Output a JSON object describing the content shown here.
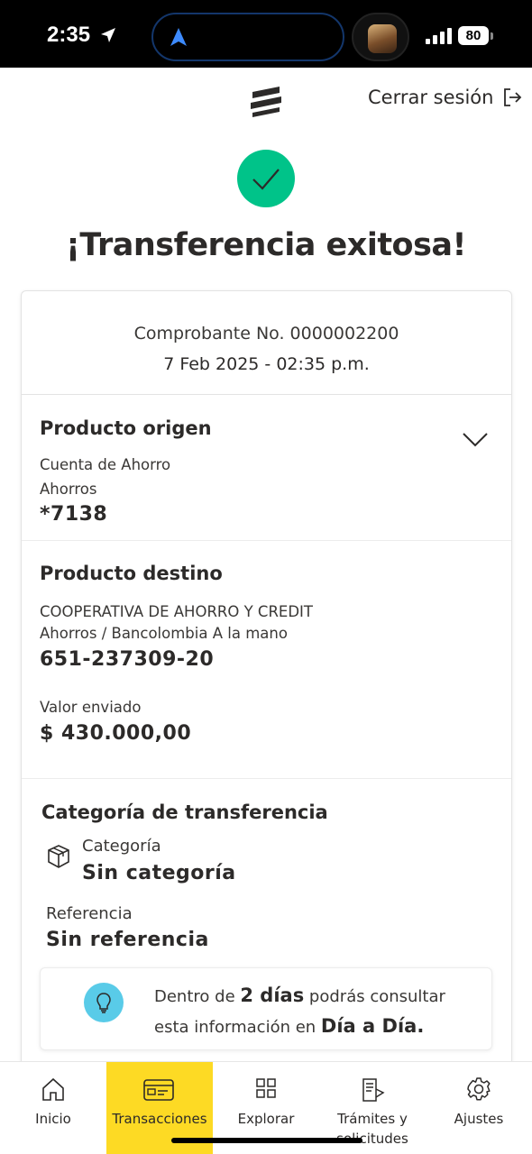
{
  "status_bar": {
    "time": "2:35",
    "battery": "80"
  },
  "header": {
    "logout_label": "Cerrar sesión"
  },
  "success": {
    "title": "¡Transferencia exitosa!"
  },
  "receipt": {
    "number": "Comprobante No. 0000002200",
    "date": "7 Feb 2025 - 02:35 p.m."
  },
  "origin": {
    "title": "Producto origen",
    "account_type": "Cuenta de Ahorro",
    "account_kind": "Ahorros",
    "account_number": "*7138"
  },
  "destination": {
    "title": "Producto destino",
    "name": "COOPERATIVA DE AHORRO Y CREDIT",
    "detail": "Ahorros / Bancolombia A la mano",
    "account_number": "651-237309-20",
    "amount_label": "Valor enviado",
    "amount": "$ 430.000,00"
  },
  "category": {
    "title": "Categoría de transferencia",
    "category_label": "Categoría",
    "category_value": "Sin categoría",
    "reference_label": "Referencia",
    "reference_value": "Sin referencia"
  },
  "info": {
    "text_1": "Dentro de ",
    "bold_1": "2 días",
    "text_2": " podrás consultar esta información en ",
    "bold_2": "Día a Día."
  },
  "nav": {
    "items": [
      {
        "label": "Inicio",
        "icon": "home-icon"
      },
      {
        "label": "Transacciones",
        "icon": "card-icon",
        "active": true
      },
      {
        "label": "Explorar",
        "icon": "grid-icon"
      },
      {
        "label": "Trámites y solicitudes",
        "icon": "document-icon"
      },
      {
        "label": "Ajustes",
        "icon": "gear-icon"
      }
    ]
  },
  "colors": {
    "success": "#00c389",
    "accent_yellow": "#fdda24",
    "info_blue": "#59cbe8",
    "text": "#2c2a29"
  }
}
